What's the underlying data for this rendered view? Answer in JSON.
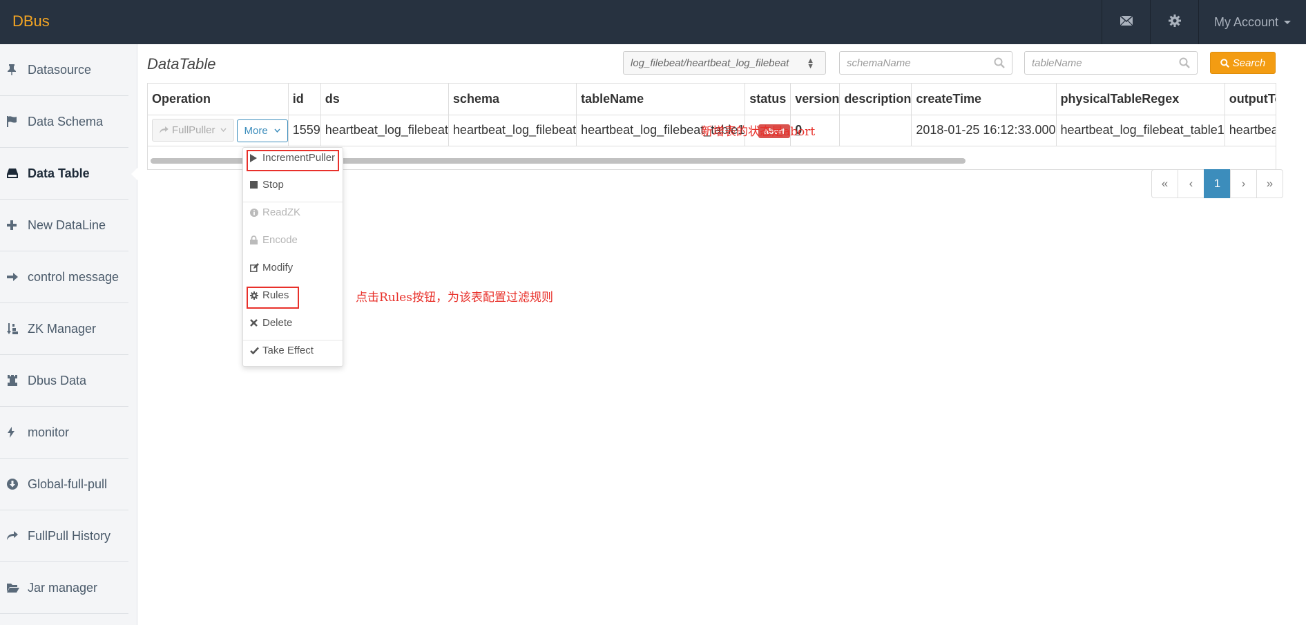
{
  "navbar": {
    "brand": "DBus",
    "mail_icon": "envelope-icon",
    "settings_icon": "gear-icon",
    "account_label": "My Account"
  },
  "sidebar": {
    "items": [
      {
        "label": "Datasource",
        "icon": "pushpin-icon"
      },
      {
        "label": "Data Schema",
        "icon": "flag-icon"
      },
      {
        "label": "Data Table",
        "icon": "hdd-icon",
        "active": true
      },
      {
        "label": "New DataLine",
        "icon": "plus-icon"
      },
      {
        "label": "control message",
        "icon": "arrow-right-icon"
      },
      {
        "label": "ZK Manager",
        "icon": "sort-icon"
      },
      {
        "label": "Dbus Data",
        "icon": "tower-icon"
      },
      {
        "label": "monitor",
        "icon": "flash-icon"
      },
      {
        "label": "Global-full-pull",
        "icon": "download-icon"
      },
      {
        "label": "FullPull History",
        "icon": "share-icon"
      },
      {
        "label": "Jar manager",
        "icon": "folder-open-icon"
      }
    ]
  },
  "main": {
    "title": "DataTable",
    "filters": {
      "datasource_selected": "log_filebeat/heartbeat_log_filebeat",
      "schema_placeholder": "schemaName",
      "table_placeholder": "tableName",
      "search_label": "Search"
    },
    "table": {
      "headers": [
        "Operation",
        "id",
        "ds",
        "schema",
        "tableName",
        "status",
        "version",
        "description",
        "createTime",
        "physicalTableRegex",
        "outputTopic"
      ],
      "row": {
        "fullpuller_label": "FullPuller",
        "more_label": "More",
        "id": "1559",
        "ds": "heartbeat_log_filebeat",
        "schema": "heartbeat_log_filebeat",
        "tableName": "heartbeat_log_filebeat_table1",
        "status": "abort",
        "version": "0",
        "description": "",
        "createTime": "2018-01-25 16:12:33.000",
        "physicalTableRegex": "heartbeat_log_filebeat_table1",
        "outputTopic": "heartbeat_log_filebeat"
      }
    },
    "pagination": {
      "first": "«",
      "prev": "‹",
      "current": "1",
      "next": "›",
      "last": "»"
    },
    "dropdown": {
      "items": [
        {
          "label": "IncrementPuller",
          "icon": "play-icon",
          "disabled": false
        },
        {
          "label": "Stop",
          "icon": "stop-icon",
          "disabled": false
        },
        {
          "label": "ReadZK",
          "icon": "info-icon",
          "disabled": true
        },
        {
          "label": "Encode",
          "icon": "lock-icon",
          "disabled": true
        },
        {
          "label": "Modify",
          "icon": "edit-icon",
          "disabled": false
        },
        {
          "label": "Rules",
          "icon": "cog-icon",
          "disabled": false
        },
        {
          "label": "Delete",
          "icon": "remove-icon",
          "disabled": false
        },
        {
          "label": "Take Effect",
          "icon": "ok-icon",
          "disabled": false
        }
      ]
    },
    "annotations": {
      "status_note": "新增表的状态是abort",
      "rules_note": "点击Rules按钮，为该表配置过滤规则"
    }
  },
  "colors": {
    "navbar_bg": "#273240",
    "brand": "#f5a623",
    "primary": "#3c8dbc",
    "search_btn": "#f39c12",
    "abort_badge": "#d9534f",
    "annotation": "#e8302a"
  }
}
